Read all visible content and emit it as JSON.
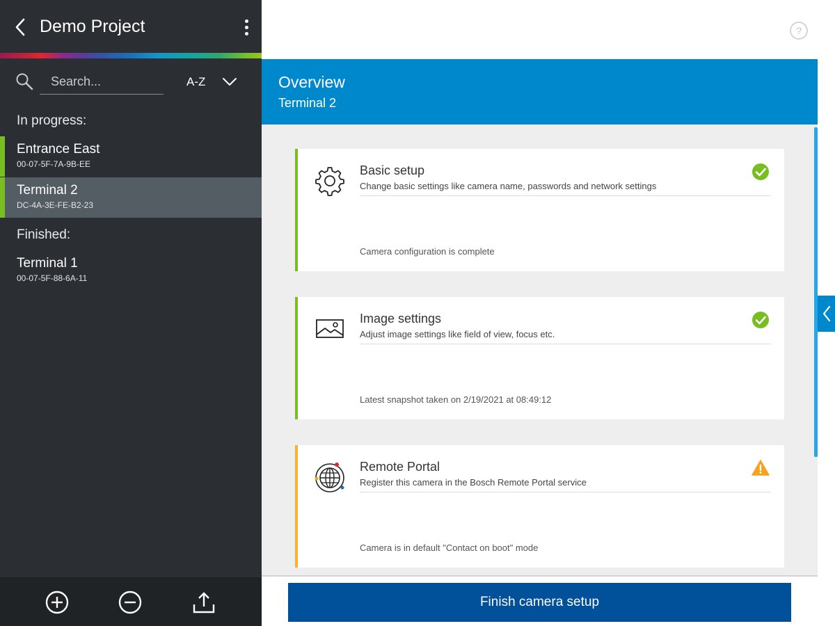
{
  "sidebar": {
    "project_title": "Demo Project",
    "search_placeholder": "Search...",
    "sort_label": "A-Z",
    "in_progress_label": "In progress:",
    "finished_label": "Finished:",
    "in_progress": [
      {
        "name": "Entrance East",
        "mac": "00-07-5F-7A-9B-EE",
        "selected": false
      },
      {
        "name": "Terminal 2",
        "mac": "DC-4A-3E-FE-B2-23",
        "selected": true
      }
    ],
    "finished": [
      {
        "name": "Terminal 1",
        "mac": "00-07-5F-88-6A-11"
      }
    ],
    "footer_icons": [
      "add-icon",
      "remove-icon",
      "share-icon"
    ]
  },
  "header": {
    "overview_title": "Overview",
    "overview_subtitle": "Terminal 2"
  },
  "cards": [
    {
      "title": "Basic setup",
      "description": "Change basic settings like camera name, passwords and network settings",
      "status": "Camera configuration is complete",
      "state": "complete",
      "icon": "gear-icon"
    },
    {
      "title": "Image settings",
      "description": "Adjust image settings like field of view, focus etc.",
      "status": "Latest snapshot taken on 2/19/2021 at 08:49:12",
      "state": "complete",
      "icon": "image-icon"
    },
    {
      "title": "Remote Portal",
      "description": "Register this camera in the Bosch Remote Portal service",
      "status": "Camera is in default \"Contact on boot\" mode",
      "state": "warning",
      "icon": "globe-icon"
    }
  ],
  "footer": {
    "finish_label": "Finish camera setup"
  },
  "colors": {
    "sidebar_bg": "#2b2f33",
    "selected_bg": "#545c64",
    "accent_green": "#78be20",
    "accent_orange": "#ffaf29",
    "overview_blue": "#0088cc",
    "button_blue": "#00509a",
    "check_green": "#78be20",
    "warning_orange": "#f6a21a"
  }
}
